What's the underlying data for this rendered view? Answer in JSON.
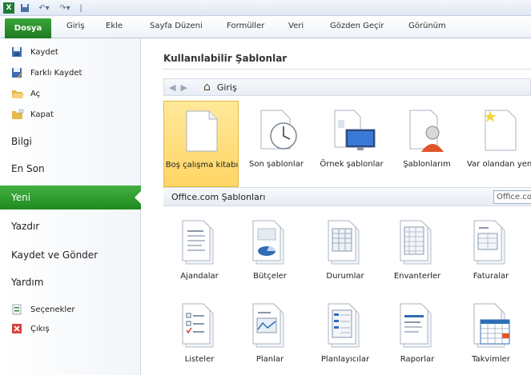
{
  "ribbon": {
    "file_tab": "Dosya",
    "tabs": [
      "Giriş",
      "Ekle",
      "Sayfa Düzeni",
      "Formüller",
      "Veri",
      "Gözden Geçir",
      "Görünüm"
    ]
  },
  "nav": {
    "commands_top": [
      {
        "label": "Kaydet",
        "icon": "floppy-disk-icon"
      },
      {
        "label": "Farklı Kaydet",
        "icon": "save-as-icon"
      },
      {
        "label": "Aç",
        "icon": "open-folder-icon"
      },
      {
        "label": "Kapat",
        "icon": "close-folder-icon"
      }
    ],
    "tabs": [
      "Bilgi",
      "En Son",
      "Yeni",
      "Yazdır",
      "Kaydet ve Gönder",
      "Yardım"
    ],
    "selected_tab": "Yeni",
    "commands_bottom": [
      {
        "label": "Seçenekler",
        "icon": "options-icon"
      },
      {
        "label": "Çıkış",
        "icon": "exit-icon"
      }
    ]
  },
  "main": {
    "section_title": "Kullanılabilir Şablonlar",
    "breadcrumb": "Giriş",
    "templates": [
      {
        "label": "Boş çalışma kitabı",
        "icon": "blank-workbook-icon",
        "selected": true
      },
      {
        "label": "Son şablonlar",
        "icon": "recent-templates-icon"
      },
      {
        "label": "Örnek şablonlar",
        "icon": "sample-templates-icon"
      },
      {
        "label": "Şablonlarım",
        "icon": "my-templates-icon"
      },
      {
        "label": "Var olandan yeni",
        "icon": "new-from-existing-icon"
      }
    ],
    "office_title": "Office.com Şablonları",
    "office_search_value": "Office.co",
    "office_categories": [
      {
        "label": "Ajandalar",
        "icon": "agenda-icon"
      },
      {
        "label": "Bütçeler",
        "icon": "budget-icon"
      },
      {
        "label": "Durumlar",
        "icon": "statement-icon"
      },
      {
        "label": "Envanterler",
        "icon": "inventory-icon"
      },
      {
        "label": "Faturalar",
        "icon": "invoice-icon"
      },
      {
        "label": "Listeler",
        "icon": "list-icon"
      },
      {
        "label": "Planlar",
        "icon": "plan-icon"
      },
      {
        "label": "Planlayıcılar",
        "icon": "planner-icon"
      },
      {
        "label": "Raporlar",
        "icon": "report-icon"
      },
      {
        "label": "Takvimler",
        "icon": "calendar-icon"
      }
    ]
  },
  "colors": {
    "accent": "#2a962a",
    "selected_tile": "#ffd565"
  }
}
